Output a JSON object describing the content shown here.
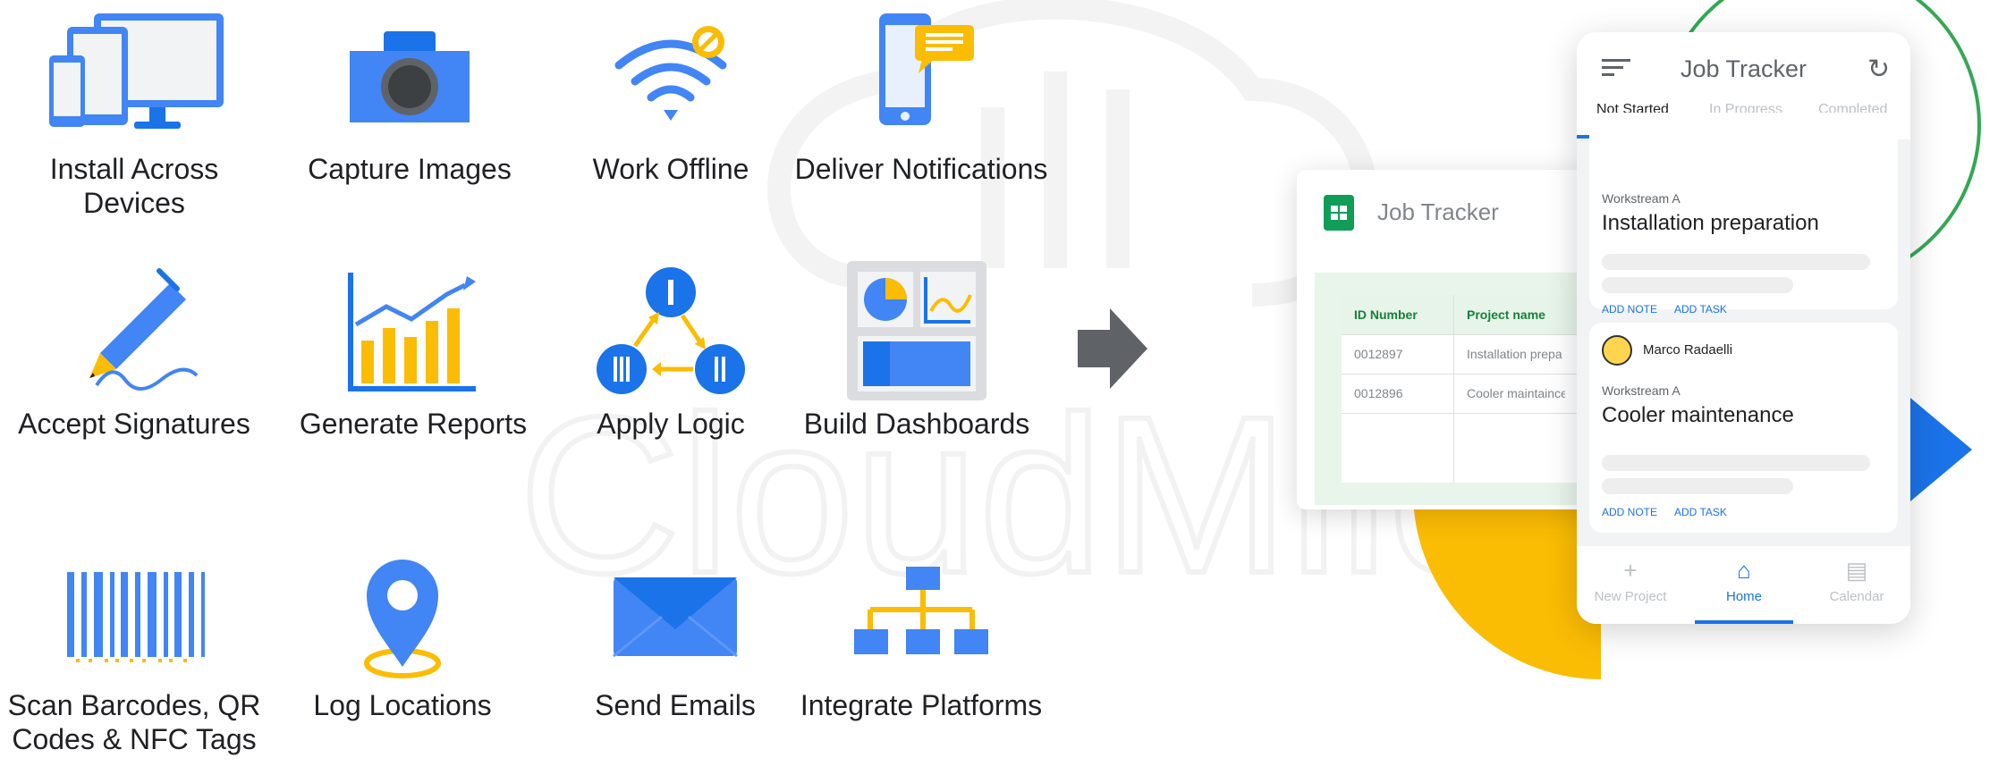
{
  "features": [
    {
      "icon": "devices-icon",
      "label": "Install Across Devices"
    },
    {
      "icon": "camera-icon",
      "label": "Capture Images"
    },
    {
      "icon": "wifi-off-icon",
      "label": "Work Offline"
    },
    {
      "icon": "phone-notification-icon",
      "label": "Deliver Notifications"
    },
    {
      "icon": "pen-signature-icon",
      "label": "Accept Signatures"
    },
    {
      "icon": "bar-chart-icon",
      "label": "Generate Reports"
    },
    {
      "icon": "logic-flow-icon",
      "label": "Apply Logic"
    },
    {
      "icon": "dashboard-icon",
      "label": "Build Dashboards"
    },
    {
      "icon": "barcode-icon",
      "label": "Scan Barcodes, QR Codes & NFC Tags"
    },
    {
      "icon": "location-pin-icon",
      "label": "Log Locations"
    },
    {
      "icon": "email-icon",
      "label": "Send Emails"
    },
    {
      "icon": "org-chart-icon",
      "label": "Integrate Platforms"
    }
  ],
  "watermark_text": "CloudMile",
  "sheet": {
    "title": "Job Tracker",
    "columns": [
      "ID Number",
      "Project name"
    ],
    "rows": [
      [
        "0012897",
        "Installation prepa"
      ],
      [
        "0012896",
        "Cooler maintaince"
      ]
    ]
  },
  "app": {
    "title": "Job Tracker",
    "tabs": [
      "Not Started",
      "In Progress",
      "Completed"
    ],
    "active_tab": "Not Started",
    "cards": [
      {
        "workstream": "Workstream A",
        "project": "Installation preparation",
        "note_action": "ADD NOTE",
        "task_action": "ADD TASK"
      },
      {
        "assignee": "Marco Radaelli",
        "workstream": "Workstream A",
        "project": "Cooler maintenance",
        "note_action": "ADD NOTE",
        "task_action": "ADD TASK"
      }
    ],
    "nav": [
      {
        "icon": "plus-icon",
        "label": "New Project"
      },
      {
        "icon": "home-icon",
        "label": "Home"
      },
      {
        "icon": "calendar-icon",
        "label": "Calendar"
      }
    ],
    "active_nav": "Home"
  },
  "colors": {
    "blue": "#4285f4",
    "dark_blue": "#1a73e8",
    "yellow": "#fbbc04",
    "green": "#34a853",
    "red": "#ea4335",
    "sheets_green": "#0f9d58"
  }
}
